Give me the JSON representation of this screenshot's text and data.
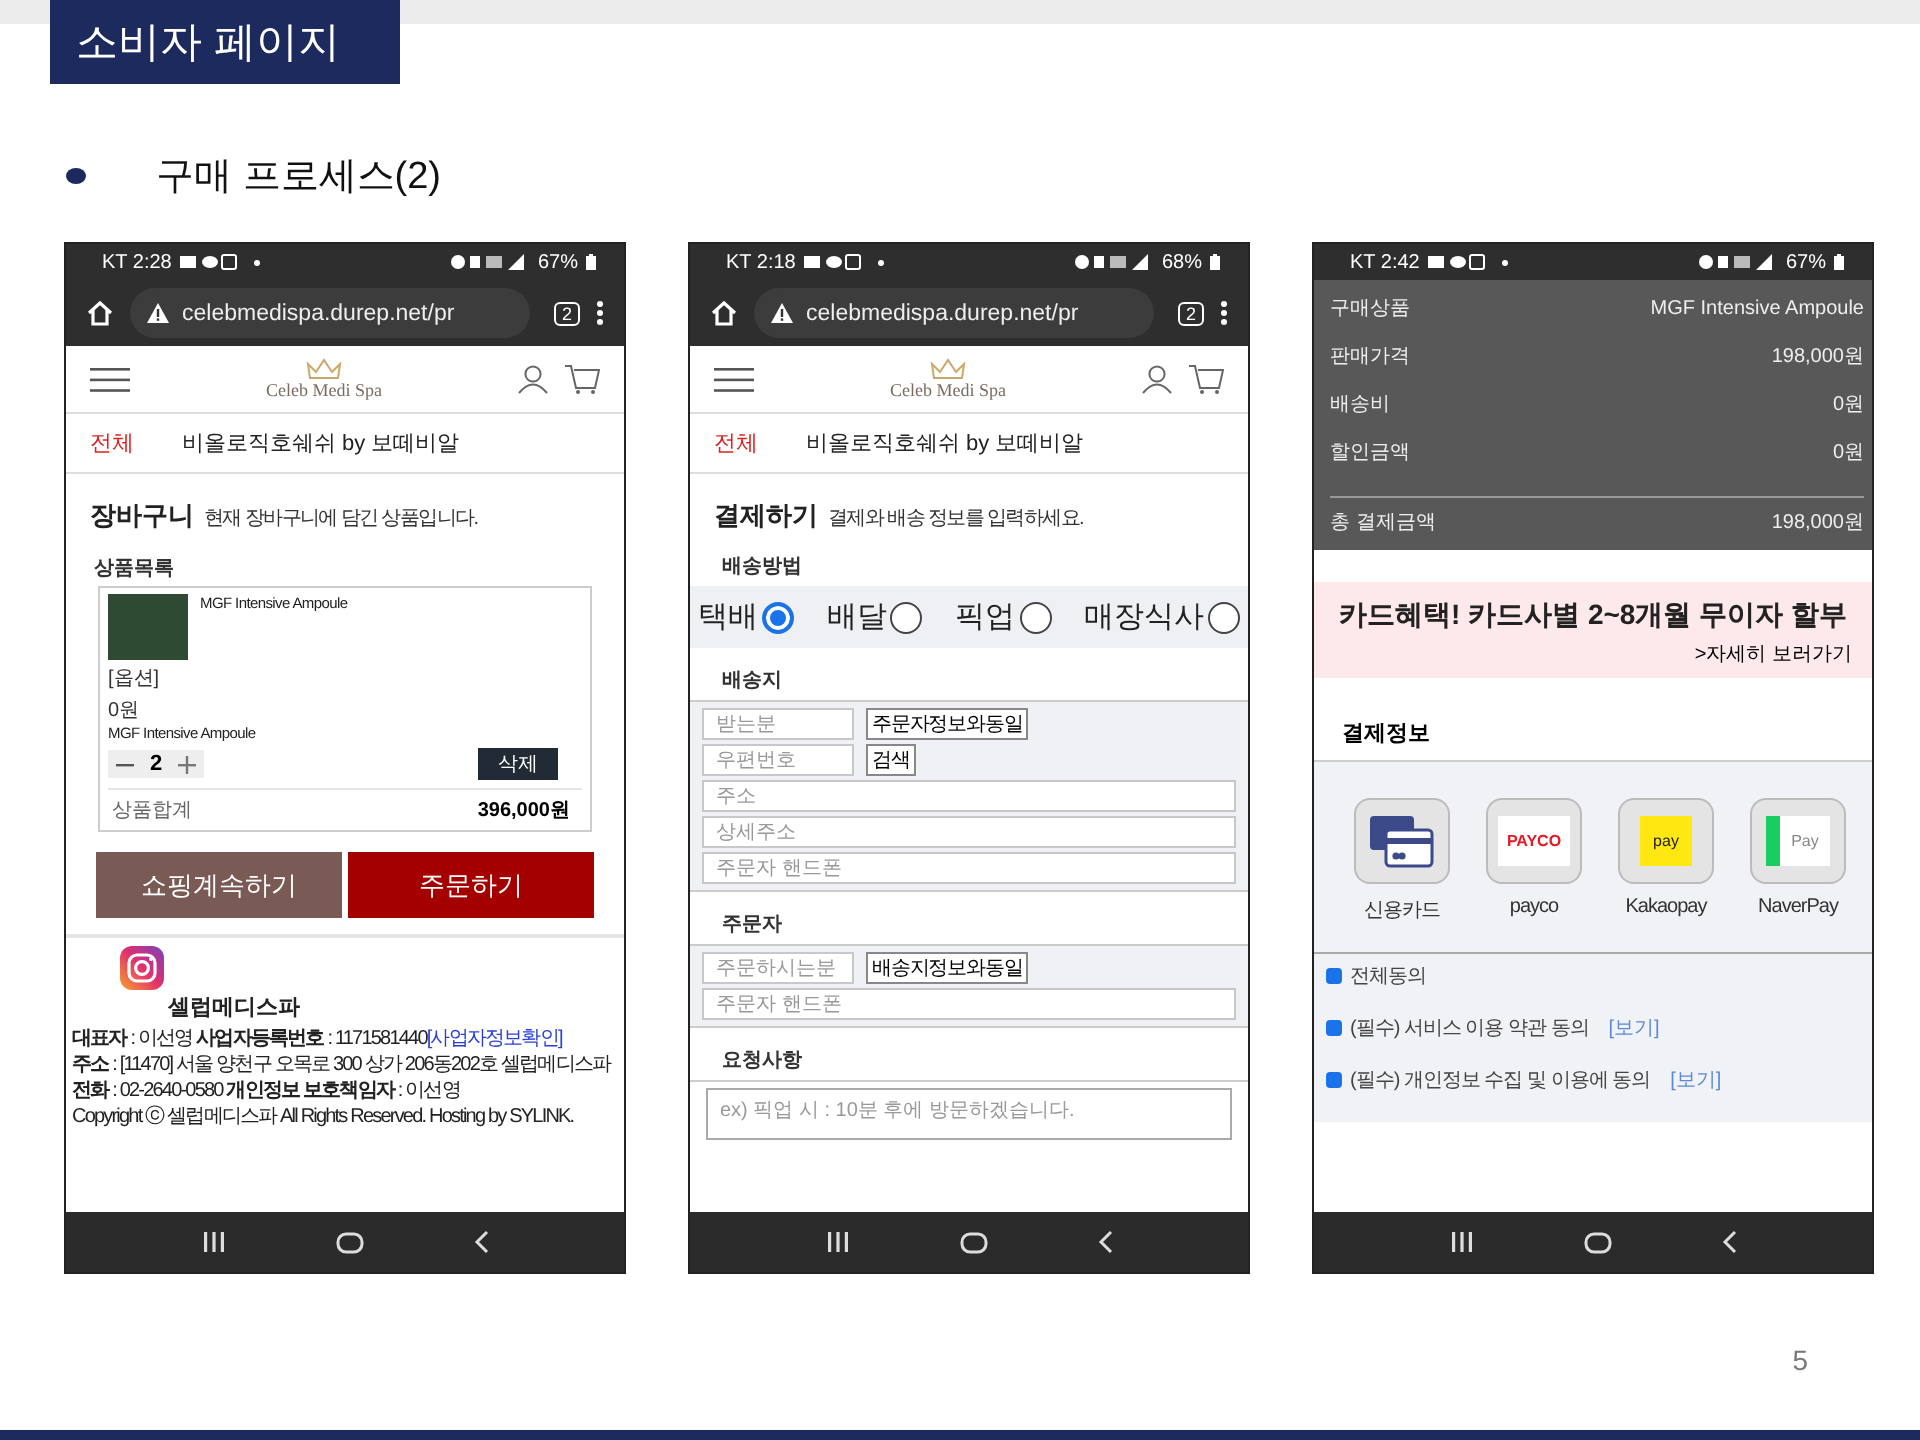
{
  "slide": {
    "title": "소비자 페이지",
    "bullet": "구매 프로세스(2)",
    "page_number": "5"
  },
  "phones": [
    {
      "kind": "cart",
      "status": {
        "time": "KT 2:28",
        "battery": "67%"
      },
      "browser": {
        "url": "celebmedispa.durep.net/pr",
        "tab_count": "2"
      },
      "site": {
        "logo": "Celeb Medi Spa",
        "category": "전체",
        "brand": "비올로직호쉐쉬 by 보떼비알"
      },
      "cart": {
        "title": "장바구니",
        "subtitle": "현재 장바구니에 담긴 상품입니다.",
        "list_label": "상품목록",
        "item": {
          "name": "MGF Intensive Ampoule",
          "option_label": "[옵션]",
          "option_price": "0원",
          "option_name": "MGF Intensive Ampoule",
          "quantity": "2",
          "delete": "삭제"
        },
        "total_label": "상품합계",
        "total": "396,000원",
        "buttons": [
          {
            "label": "쇼핑계속하기",
            "kind": "secondary"
          },
          {
            "label": "주문하기",
            "kind": "primary"
          }
        ]
      },
      "footer": {
        "company": "셀럽메디스파",
        "lines": [
          {
            "text": "**대표자** : 이선영  **사업자등록번호** : 1171581440",
            "link": "[사업자정보확인]"
          },
          {
            "text": "**주소** : [11470] 서울 양천구 오목로 300 상가 206동202호 셀럽메디스파"
          },
          {
            "text": "**전화** : 02-2640-0580  **개인정보 보호책임자** : 이선영"
          },
          {
            "text": "Copyright ⓒ 셀럽메디스파 All Rights Reserved. Hosting by SYLINK."
          }
        ]
      }
    },
    {
      "kind": "checkout",
      "status": {
        "time": "KT 2:18",
        "battery": "68%"
      },
      "browser": {
        "url": "celebmedispa.durep.net/pr",
        "tab_count": "2"
      },
      "site": {
        "logo": "Celeb Medi Spa",
        "category": "전체",
        "brand": "비올로직호쉐쉬 by 보떼비알"
      },
      "checkout": {
        "title": "결제하기",
        "subtitle": "결제와 배송 정보를 입력하세요.",
        "shipping_label": "배송방법",
        "methods": [
          {
            "label": "택배",
            "selected": true
          },
          {
            "label": "배달",
            "selected": false
          },
          {
            "label": "픽업",
            "selected": false
          },
          {
            "label": "매장식사",
            "selected": false
          }
        ],
        "sections": [
          {
            "title": "배송지",
            "rows": [
              {
                "placeholder": "받는분",
                "button": "주문자정보와동일"
              },
              {
                "placeholder": "우편번호",
                "button": "검색"
              },
              {
                "placeholder": "주소"
              },
              {
                "placeholder": "상세주소"
              },
              {
                "placeholder": "주문자 핸드폰"
              }
            ]
          },
          {
            "title": "주문자",
            "rows": [
              {
                "placeholder": "주문하시는분",
                "button": "배송지정보와동일"
              },
              {
                "placeholder": "주문자 핸드폰"
              }
            ]
          }
        ],
        "request": {
          "title": "요청사항",
          "placeholder": "ex) 픽업 시 : 10분 후에 방문하겠습니다."
        }
      }
    },
    {
      "kind": "payment",
      "status": {
        "time": "KT 2:42",
        "battery": "67%"
      },
      "summary": {
        "rows": [
          {
            "label": "구매상품",
            "value": "MGF Intensive Ampoule"
          },
          {
            "label": "판매가격",
            "value": "198,000원"
          },
          {
            "label": "배송비",
            "value": "0원"
          },
          {
            "label": "할인금액",
            "value": "0원"
          }
        ],
        "total": {
          "label": "총 결제금액",
          "value": "198,000원"
        }
      },
      "banner": {
        "headline": "카드혜택! 카드사별 2~8개월 무이자 할부",
        "link": ">자세히 보러가기"
      },
      "payment_title": "결제정보",
      "methods": [
        {
          "kind": "card",
          "label": "신용카드"
        },
        {
          "kind": "payco",
          "logo_text": "PAYCO",
          "label": "payco"
        },
        {
          "kind": "kakao",
          "logo_text": "pay",
          "label": "Kakaopay"
        },
        {
          "kind": "naver",
          "logo_text": "Pay",
          "label": "NaverPay"
        }
      ],
      "agreements": [
        {
          "text": "전체동의",
          "checked": true
        },
        {
          "text": "(필수) 서비스 이용 약관 동의",
          "link": "[보기]",
          "checked": true
        },
        {
          "text": "(필수) 개인정보 수집 및 이용에 동의",
          "link": "[보기]",
          "checked": true
        }
      ]
    }
  ]
}
